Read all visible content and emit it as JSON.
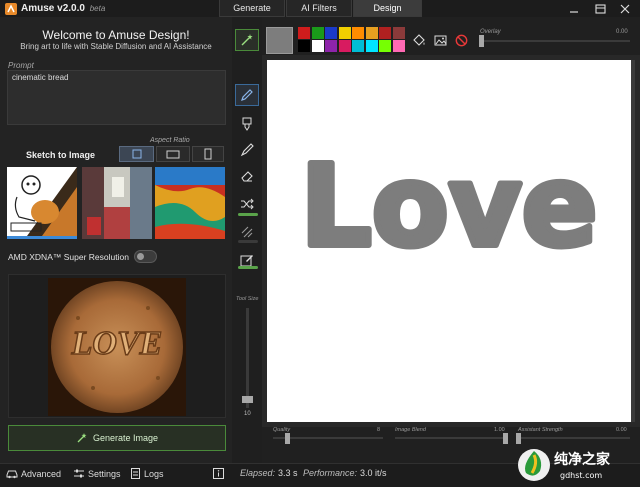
{
  "app": {
    "name": "Amuse",
    "version": "v2.0.0",
    "channel": "beta"
  },
  "tabs": [
    {
      "label": "Generate"
    },
    {
      "label": "AI Filters"
    },
    {
      "label": "Design",
      "active": true
    }
  ],
  "welcome": {
    "title": "Welcome to Amuse Design!",
    "subtitle": "Bring art to life with Stable Diffusion and AI Assistance"
  },
  "prompt": {
    "label": "Prompt",
    "value": "cinematic bread"
  },
  "sketch": {
    "label": "Sketch to Image",
    "aspect_ratio_label": "Aspect Ratio",
    "aspect_ratios": [
      "square",
      "landscape",
      "portrait"
    ],
    "selected_aspect": "square"
  },
  "super_resolution": {
    "label": "AMD XDNA™ Super Resolution",
    "enabled": false
  },
  "generate_button": {
    "label": "Generate Image"
  },
  "bottom_bar": {
    "advanced_label": "Advanced",
    "settings_label": "Settings",
    "logs_label": "Logs",
    "elapsed_label": "Elapsed:",
    "elapsed_value": "3.3 s",
    "performance_label": "Performance:",
    "performance_value": "3.0 it/s"
  },
  "tools": [
    "magic-wand",
    "pen",
    "brush",
    "pencil",
    "eraser",
    "shuffle",
    "lines",
    "edit"
  ],
  "tool_size": {
    "label": "Tool Size",
    "value": "10"
  },
  "palette": {
    "current_color": "#7d7d7d",
    "swatches_row1": [
      "#d01c1c",
      "#1a9a1a",
      "#1a3ac8",
      "#f0d000",
      "#ff8c00",
      "#e8a020",
      "#b02020",
      "#8b3a3a"
    ],
    "swatches_row2": [
      "#000000",
      "#ffffff",
      "#8e24aa",
      "#d81b60",
      "#00bcd4",
      "#00e5ff",
      "#76ff03",
      "#ff69b4"
    ]
  },
  "overlay": {
    "label": "Overlay",
    "value": "0.00"
  },
  "sliders": {
    "quality_label": "Quality",
    "quality_value": "8",
    "image_blend_label": "Image Blend",
    "image_blend_value": "1.00",
    "assistant_strength_label": "Assistant Strength",
    "assistant_strength_value": "0.00"
  },
  "sketch_text": "Love",
  "output_text": "LOVE",
  "watermark": {
    "title": "纯净之家",
    "url": "gdhst.com"
  },
  "colors": {
    "accent_green": "#4a8a3a",
    "accent_blue": "#3c8ad8",
    "sketch_stroke": "#7d7d7d"
  }
}
